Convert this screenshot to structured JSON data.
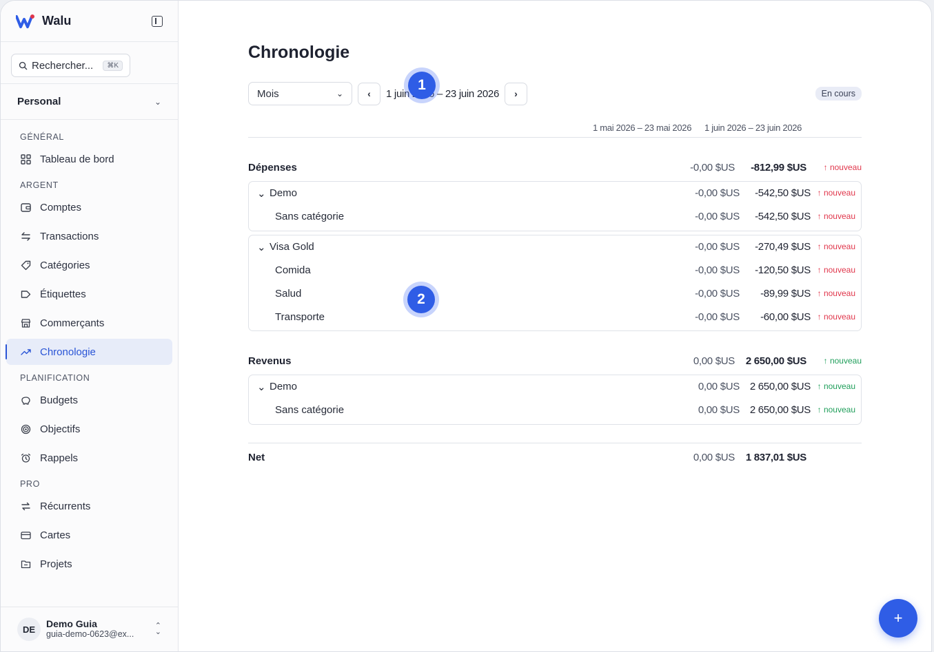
{
  "app": {
    "name": "Walu"
  },
  "search": {
    "placeholder": "Rechercher...",
    "shortcut": "⌘K"
  },
  "workspace": {
    "name": "Personal"
  },
  "sidebar": {
    "sections": [
      {
        "title": "GÉNÉRAL",
        "items": [
          {
            "label": "Tableau de bord",
            "icon": "dashboard-icon"
          }
        ]
      },
      {
        "title": "ARGENT",
        "items": [
          {
            "label": "Comptes",
            "icon": "wallet-icon"
          },
          {
            "label": "Transactions",
            "icon": "arrows-icon"
          },
          {
            "label": "Catégories",
            "icon": "tag-icon"
          },
          {
            "label": "Étiquettes",
            "icon": "label-icon"
          },
          {
            "label": "Commerçants",
            "icon": "store-icon"
          },
          {
            "label": "Chronologie",
            "icon": "trend-icon",
            "active": true
          }
        ]
      },
      {
        "title": "PLANIFICATION",
        "items": [
          {
            "label": "Budgets",
            "icon": "piggy-icon"
          },
          {
            "label": "Objectifs",
            "icon": "target-icon"
          },
          {
            "label": "Rappels",
            "icon": "alarm-icon"
          }
        ]
      },
      {
        "title": "PRO",
        "items": [
          {
            "label": "Récurrents",
            "icon": "repeat-icon"
          },
          {
            "label": "Cartes",
            "icon": "card-icon"
          },
          {
            "label": "Projets",
            "icon": "folder-icon"
          }
        ]
      }
    ]
  },
  "user": {
    "initials": "DE",
    "name": "Demo Guia",
    "email": "guia-demo-0623@ex..."
  },
  "page": {
    "title": "Chronologie",
    "period_select": "Mois",
    "range_label": "1 juin 2026 – 23 juin 2026",
    "status": "En cours",
    "period_a": "1 mai 2026 – 23 mai 2026",
    "period_b": "1 juin 2026 – 23 juin 2026"
  },
  "expenses": {
    "label": "Dépenses",
    "a": "-0,00 $US",
    "b": "-812,99 $US",
    "tag": "↑ nouveau",
    "groups": [
      {
        "name": "Demo",
        "a": "-0,00 $US",
        "b": "-542,50 $US",
        "tag": "↑ nouveau",
        "rows": [
          {
            "name": "Sans catégorie",
            "a": "-0,00 $US",
            "b": "-542,50 $US",
            "tag": "↑ nouveau"
          }
        ]
      },
      {
        "name": "Visa Gold",
        "a": "-0,00 $US",
        "b": "-270,49 $US",
        "tag": "↑ nouveau",
        "rows": [
          {
            "name": "Comida",
            "a": "-0,00 $US",
            "b": "-120,50 $US",
            "tag": "↑ nouveau"
          },
          {
            "name": "Salud",
            "a": "-0,00 $US",
            "b": "-89,99 $US",
            "tag": "↑ nouveau"
          },
          {
            "name": "Transporte",
            "a": "-0,00 $US",
            "b": "-60,00 $US",
            "tag": "↑ nouveau"
          }
        ]
      }
    ]
  },
  "income": {
    "label": "Revenus",
    "a": "0,00 $US",
    "b": "2 650,00 $US",
    "tag": "↑ nouveau",
    "groups": [
      {
        "name": "Demo",
        "a": "0,00 $US",
        "b": "2 650,00 $US",
        "tag": "↑ nouveau",
        "rows": [
          {
            "name": "Sans catégorie",
            "a": "0,00 $US",
            "b": "2 650,00 $US",
            "tag": "↑ nouveau"
          }
        ]
      }
    ]
  },
  "net": {
    "label": "Net",
    "a": "0,00 $US",
    "b": "1 837,01 $US"
  },
  "markers": {
    "one": "1",
    "two": "2"
  },
  "fab": {
    "label": "+"
  },
  "colors": {
    "accent": "#2f5de6",
    "negative": "#e0364b",
    "positive": "#1f9e5a"
  }
}
